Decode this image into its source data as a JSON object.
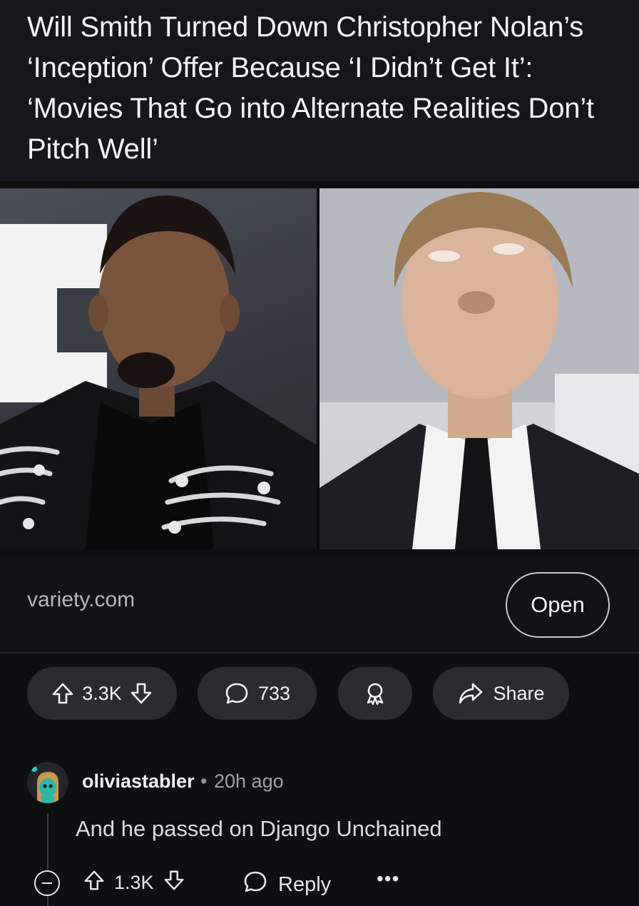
{
  "post": {
    "headline": "Will Smith Turned Down Christopher Nolan’s ‘Inception’ Offer Because ‘I Didn’t Get It’: ‘Movies That Go into Alternate Realities Don’t Pitch Well’",
    "domain": "variety.com",
    "open_label": "Open",
    "upvotes": "3.3K",
    "comments_count": "733",
    "share_label": "Share"
  },
  "comment": {
    "username": "oliviastabler",
    "separator": "•",
    "time": "20h ago",
    "body": "And he passed on Django Unchained",
    "upvotes": "1.3K",
    "reply_label": "Reply",
    "more_label": "•••"
  },
  "icons": {
    "upvote": "arrow-up-outline-icon",
    "downvote": "arrow-down-outline-icon",
    "comment": "speech-bubble-icon",
    "award": "award-ribbon-icon",
    "share": "share-arrow-icon",
    "collapse": "minus-circle-icon",
    "reply": "speech-bubble-icon",
    "more": "ellipsis-icon"
  },
  "colors": {
    "background": "#0e0f11",
    "pill": "#2a2c30",
    "text": "#f2f3f4",
    "muted": "#9ea2a8"
  }
}
